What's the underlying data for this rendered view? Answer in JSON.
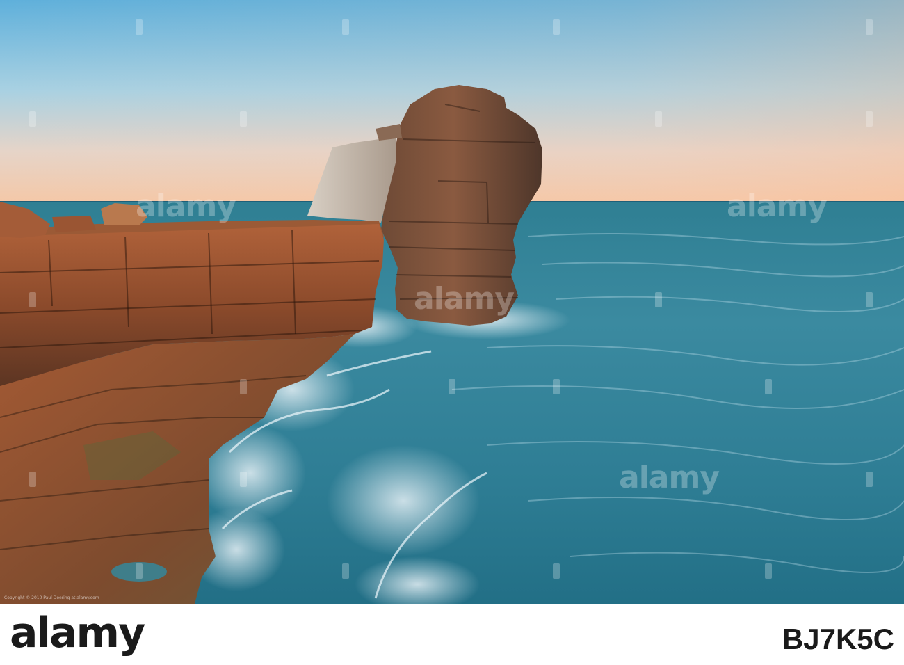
{
  "footer": {
    "brand": "alamy",
    "image_id": "BJ7K5C"
  },
  "watermark": {
    "text": "alamy"
  },
  "copyright": "Copyright © 2010 Paul Deering at alamy.com"
}
